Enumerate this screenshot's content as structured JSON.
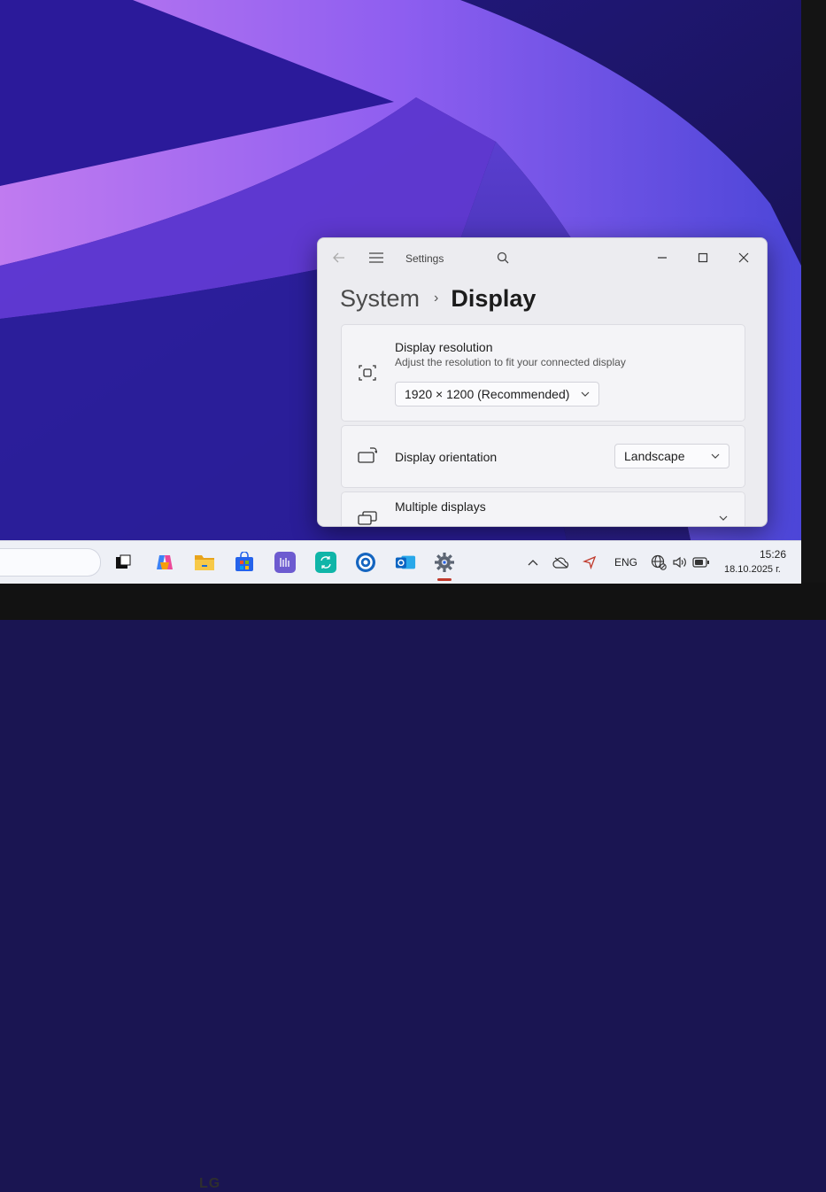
{
  "window": {
    "app_title": "Settings",
    "breadcrumb": {
      "parent": "System",
      "separator": "›",
      "current": "Display"
    }
  },
  "settings": {
    "resolution": {
      "title": "Display resolution",
      "description": "Adjust the resolution to fit your connected display",
      "value": "1920 × 1200 (Recommended)"
    },
    "orientation": {
      "title": "Display orientation",
      "value": "Landscape"
    },
    "multiple_displays": {
      "title": "Multiple displays"
    }
  },
  "taskbar": {
    "apps": [
      "task-view",
      "copilot",
      "file-explorer",
      "microsoft-store",
      "calculator-app",
      "sync-app",
      "circle-app",
      "outlook",
      "settings"
    ],
    "tray": {
      "language": "ENG"
    },
    "clock": {
      "time": "15:26",
      "date": "18.10.2025 г."
    }
  },
  "bezel": {
    "brand": "LG"
  },
  "colors": {
    "accent": "#0067c0",
    "wallpaper_purple": "#7a4fe0",
    "active_indicator": "#c0392b"
  }
}
